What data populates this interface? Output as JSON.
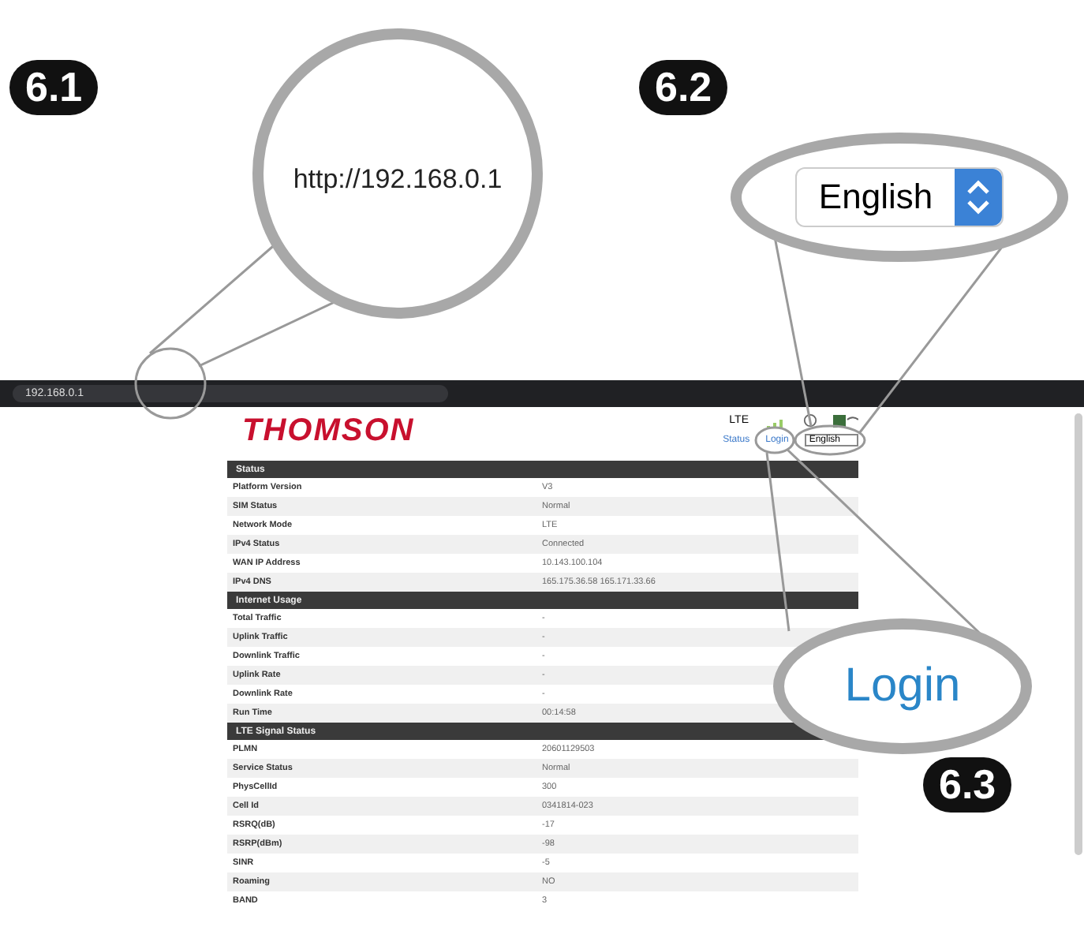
{
  "callouts": [
    {
      "badge": "6.1",
      "kind": "url",
      "text": "http://192.168.0.1"
    },
    {
      "badge": "6.2",
      "kind": "select",
      "text": "English"
    },
    {
      "badge": "6.3",
      "kind": "link",
      "text": "Login"
    }
  ],
  "browser": {
    "address": "192.168.0.1"
  },
  "header": {
    "logo": "THOMSON",
    "network": "LTE",
    "status_link": "Status",
    "login_link": "Login",
    "language": "English"
  },
  "sections": [
    {
      "title": "Status",
      "rows": [
        [
          "Platform Version",
          "V3"
        ],
        [
          "SIM Status",
          "Normal"
        ],
        [
          "Network Mode",
          "LTE"
        ],
        [
          "IPv4 Status",
          "Connected"
        ],
        [
          "WAN IP Address",
          "10.143.100.104"
        ],
        [
          "IPv4 DNS",
          "165.175.36.58 165.171.33.66"
        ]
      ]
    },
    {
      "title": "Internet Usage",
      "rows": [
        [
          "Total Traffic",
          "-"
        ],
        [
          "Uplink Traffic",
          "-"
        ],
        [
          "Downlink Traffic",
          "-"
        ],
        [
          "Uplink Rate",
          "-"
        ],
        [
          "Downlink Rate",
          "-"
        ],
        [
          "Run Time",
          "00:14:58"
        ]
      ]
    },
    {
      "title": "LTE Signal Status",
      "rows": [
        [
          "PLMN",
          "20601129503"
        ],
        [
          "Service Status",
          "Normal"
        ],
        [
          "PhysCellId",
          "300"
        ],
        [
          "Cell Id",
          "0341814-023"
        ],
        [
          "RSRQ(dB)",
          "-17"
        ],
        [
          "RSRP(dBm)",
          "-98"
        ],
        [
          "SINR",
          "-5"
        ],
        [
          "Roaming",
          "NO"
        ],
        [
          "BAND",
          "3"
        ]
      ]
    }
  ]
}
